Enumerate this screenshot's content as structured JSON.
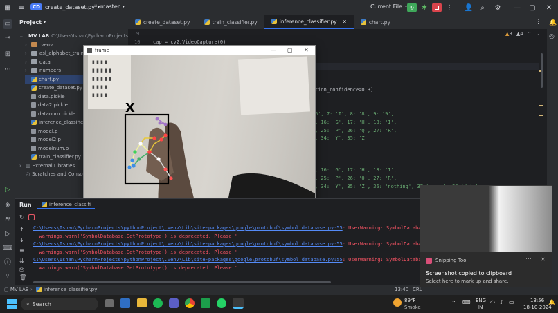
{
  "titlebar": {
    "project_badge": "CD",
    "file_name": "create_dataset.py",
    "branch": "master",
    "run_config": "Current File"
  },
  "project_panel": {
    "title": "Project",
    "root_name": "MV LAB",
    "root_path": "C:\\Users\\Ishan\\PycharmProjects",
    "items": [
      {
        "label": ".venv",
        "type": "folder-orange"
      },
      {
        "label": "asl_alphabet_train",
        "type": "folder"
      },
      {
        "label": "data",
        "type": "folder"
      },
      {
        "label": "numbers",
        "type": "folder"
      },
      {
        "label": "chart.py",
        "type": "py"
      },
      {
        "label": "create_dataset.py",
        "type": "py"
      },
      {
        "label": "data.pickle",
        "type": "file"
      },
      {
        "label": "data2.pickle",
        "type": "file"
      },
      {
        "label": "datanum.pickle",
        "type": "file"
      },
      {
        "label": "inference_classifier.py",
        "type": "py"
      },
      {
        "label": "model.p",
        "type": "file"
      },
      {
        "label": "model2.p",
        "type": "file"
      },
      {
        "label": "modelnum.p",
        "type": "file"
      },
      {
        "label": "train_classifier.py",
        "type": "py"
      }
    ],
    "external": "External Libraries",
    "scratches": "Scratches and Consoles"
  },
  "editor": {
    "tabs": [
      {
        "label": "create_dataset.py"
      },
      {
        "label": "train_classifier.py"
      },
      {
        "label": "inference_classifier.py"
      },
      {
        "label": "chart.py"
      }
    ],
    "warnings": "3",
    "weak_warnings": "4",
    "line_numbers": [
      "9",
      "10"
    ],
    "line_10": "cap = cv2.VideoCapture(0)",
    "frag_confidence": "tion_confidence=0.3)",
    "frag_a1": "6', 7: 'T', 8: '8', 9: '9',",
    "frag_a2": ", 16: 'G', 17: 'H', 18: 'I',",
    "frag_a3": ", 25: 'P', 26: 'Q', 27: 'R',",
    "frag_a4": ", 34: 'Y', 35: 'Z'",
    "frag_b1": ", 16: 'G', 17: 'H', 18: 'I',",
    "frag_b2": ", 25: 'P', 26: 'Q', 27: 'R',",
    "frag_b3": ", 34: 'Y', 35: 'Z', 36: 'nothing', 37:'space', 38:'delete'"
  },
  "frame_window": {
    "title": "frame",
    "predicted_char": "X"
  },
  "run_panel": {
    "tab_label": "Run",
    "config_tab": "inference_classifi",
    "lines": [
      {
        "kind": "link",
        "text": "C:\\Users\\Ishan\\PycharmProjects\\pythonProject\\.venv\\Lib\\site-packages\\google\\protobuf\\symbol_database.py:55",
        "suffix": ": UserWarning: SymbolDataba"
      },
      {
        "kind": "plain",
        "text": "  warnings.warn('SymbolDatabase.GetPrototype() is deprecated. Please '"
      },
      {
        "kind": "link",
        "text": "C:\\Users\\Ishan\\PycharmProjects\\pythonProject\\.venv\\Lib\\site-packages\\google\\protobuf\\symbol_database.py:55",
        "suffix": ": UserWarning: SymbolDataba"
      },
      {
        "kind": "plain",
        "text": "  warnings.warn('SymbolDatabase.GetPrototype() is deprecated. Please '"
      },
      {
        "kind": "link",
        "text": "C:\\Users\\Ishan\\PycharmProjects\\pythonProject\\.venv\\Lib\\site-packages\\google\\protobuf\\symbol_database.py:55",
        "suffix": ": UserWarning: SymbolDataba"
      },
      {
        "kind": "plain",
        "text": "  warnings.warn('SymbolDatabase.GetPrototype() is deprecated. Please '"
      }
    ]
  },
  "statusbar": {
    "project": "MV LAB",
    "file": "inference_classifier.py",
    "position": "13:40",
    "line_sep": "CRL"
  },
  "toast": {
    "app": "Snipping Tool",
    "title": "Screenshot copied to clipboard",
    "body": "Select here to mark up and share."
  },
  "taskbar": {
    "search": "Search",
    "weather_temp": "89°F",
    "weather_desc": "Smoke",
    "lang_top": "ENG",
    "lang_bottom": "IN",
    "time": "13:56",
    "date": "18-10-2024"
  }
}
